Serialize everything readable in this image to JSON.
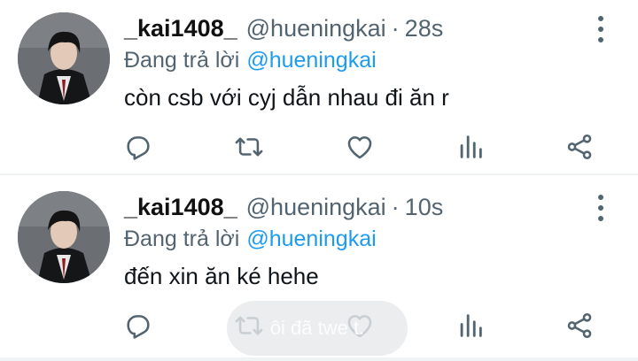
{
  "tweets": [
    {
      "display_name": "_kai1408_",
      "handle": "@hueningkai",
      "separator": "·",
      "time": "28s",
      "replying_prefix": "Đang trả lời",
      "replying_to": "@hueningkai",
      "text": "còn csb với cyj dẫn nhau đi ăn r"
    },
    {
      "display_name": "_kai1408_",
      "handle": "@hueningkai",
      "separator": "·",
      "time": "10s",
      "replying_prefix": "Đang trả lời",
      "replying_to": "@hueningkai",
      "text": "đến xin ăn ké hehe"
    }
  ],
  "icons": {
    "reply": "reply-icon",
    "retweet": "retweet-icon",
    "like": "heart-icon",
    "stats": "bar-chart-icon",
    "share": "share-icon",
    "more": "more-vertical-icon"
  },
  "toast": {
    "text": "ôi đã twe t."
  },
  "colors": {
    "text": "#0f1419",
    "muted": "#536471",
    "mention": "#1d9bf0",
    "divider": "#eff3f4"
  }
}
